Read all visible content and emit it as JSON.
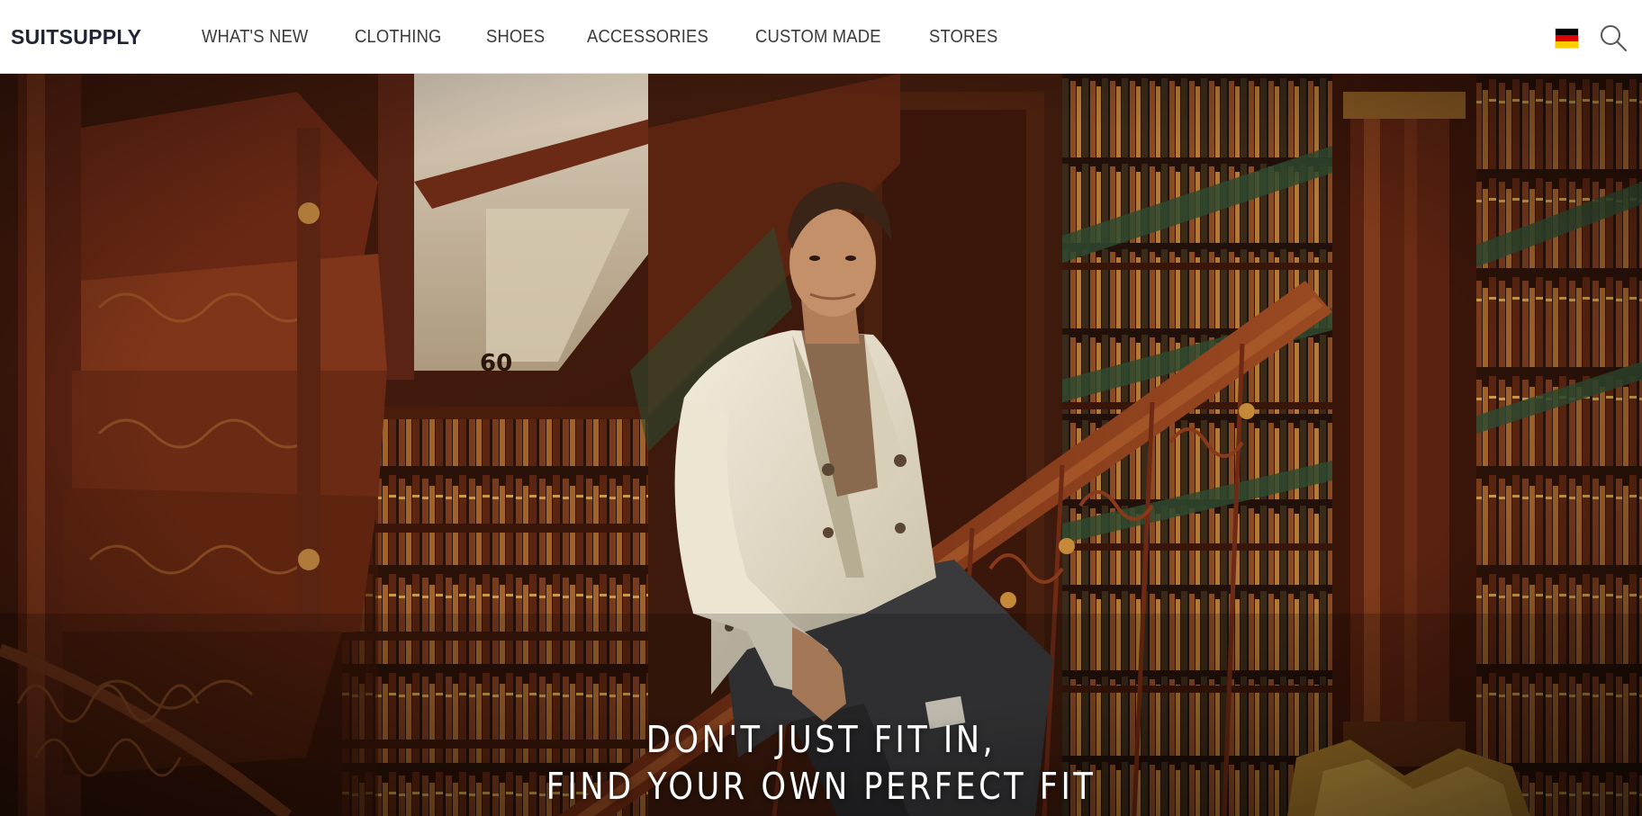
{
  "header": {
    "logo": "SUITSUPPLY",
    "nav": [
      {
        "label": "WHAT'S NEW"
      },
      {
        "label": "CLOTHING"
      },
      {
        "label": "SHOES"
      },
      {
        "label": "ACCESSORIES"
      },
      {
        "label": "CUSTOM MADE"
      },
      {
        "label": "STORES"
      }
    ],
    "country_flag_icon": "germany-flag-icon",
    "search_icon": "search-icon"
  },
  "hero": {
    "line1": "DON'T JUST FIT IN,",
    "line2": "FIND YOUR OWN PERFECT FIT",
    "shelf_label": "60"
  },
  "colors": {
    "brand_navy": "#1f2434",
    "flag_black": "#000000",
    "flag_red": "#dd0000",
    "flag_gold": "#ffce00"
  }
}
